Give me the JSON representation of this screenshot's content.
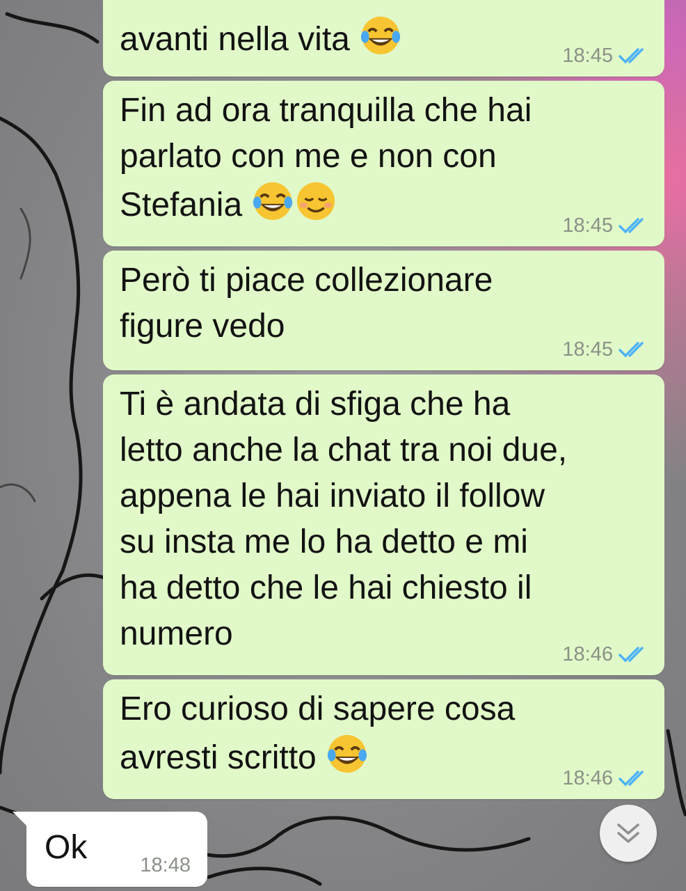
{
  "chat": {
    "messages": [
      {
        "direction": "out",
        "text": "avanti nella vita",
        "emojis": [
          "face-with-tears-of-joy-emoji"
        ],
        "time": "18:45",
        "status": "read"
      },
      {
        "direction": "out",
        "text": "Fin ad ora tranquilla che hai\nparlato con me e non con\nStefania",
        "emojis": [
          "face-with-tears-of-joy-emoji",
          "smiling-face-emoji"
        ],
        "time": "18:45",
        "status": "read"
      },
      {
        "direction": "out",
        "text": "Però ti piace collezionare\nfigure vedo",
        "emojis": [],
        "time": "18:45",
        "status": "read"
      },
      {
        "direction": "out",
        "text": "Ti è andata di sfiga che ha\nletto anche la chat tra noi due,\nappena le hai inviato il follow\nsu insta me lo ha detto e mi\nha detto che le hai chiesto il\nnumero",
        "emojis": [],
        "time": "18:46",
        "status": "read"
      },
      {
        "direction": "out",
        "text": "Ero curioso di sapere cosa\navresti scritto",
        "emojis": [
          "face-with-tears-of-joy-emoji"
        ],
        "time": "18:46",
        "status": "read"
      },
      {
        "direction": "in",
        "text": "Ok",
        "time": "18:48"
      }
    ]
  },
  "icons": {
    "read_receipt": "double-check-icon",
    "scroll_down": "double-chevron-down-icon"
  },
  "colors": {
    "outgoing_bubble": "#e1f9c8",
    "incoming_bubble": "#ffffff",
    "read_tick": "#4fb3f6",
    "timestamp": "#8b9188"
  }
}
